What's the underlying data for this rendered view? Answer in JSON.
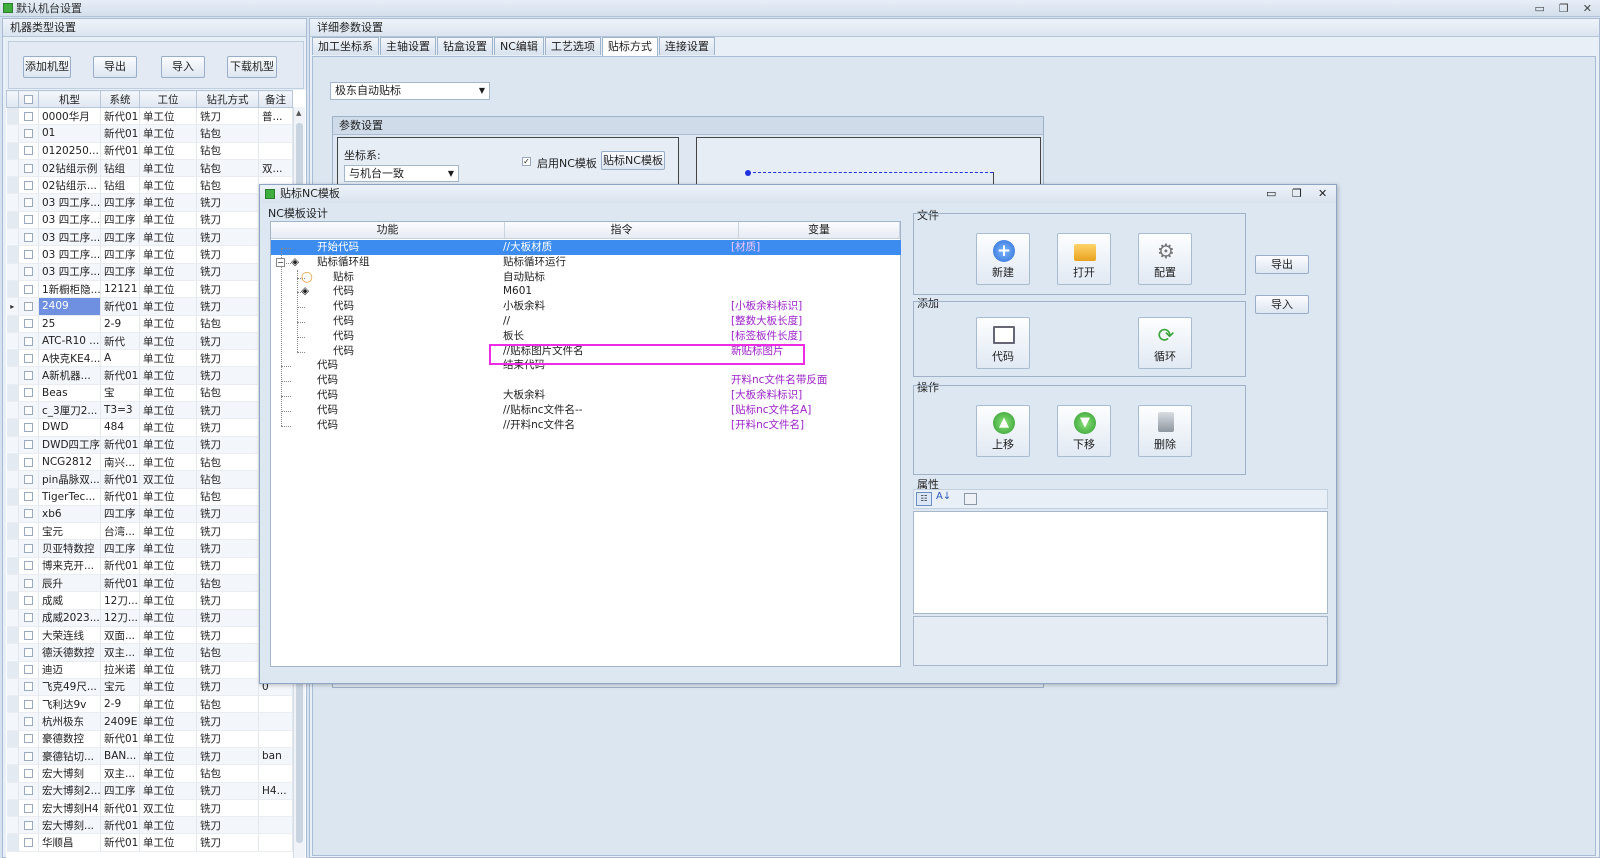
{
  "window": {
    "title": "默认机台设置",
    "controls": [
      "▭",
      "❐",
      "✕"
    ]
  },
  "machine_panel": {
    "header": "机器类型设置",
    "buttons": [
      "添加机型",
      "导出",
      "导入",
      "下载机型"
    ],
    "columns": [
      "机型",
      "系统",
      "工位",
      "钻孔方式",
      "备注"
    ],
    "rows": [
      [
        "0000华月",
        "新代01",
        "单工位",
        "铣刀",
        "普..."
      ],
      [
        "01",
        "新代01",
        "单工位",
        "钻包",
        ""
      ],
      [
        "0120250...",
        "新代01",
        "单工位",
        "钻包",
        ""
      ],
      [
        "02钻组示例",
        "钻组",
        "单工位",
        "钻包",
        "双..."
      ],
      [
        "02钻组示...",
        "钻组",
        "单工位",
        "钻包",
        ""
      ],
      [
        "03 四工序...",
        "四工序",
        "单工位",
        "铣刀",
        ""
      ],
      [
        "03 四工序...",
        "四工序",
        "单工位",
        "铣刀",
        ""
      ],
      [
        "03 四工序...",
        "四工序",
        "单工位",
        "铣刀",
        ""
      ],
      [
        "03 四工序...",
        "四工序",
        "单工位",
        "铣刀",
        ""
      ],
      [
        "03 四工序...",
        "四工序",
        "单工位",
        "铣刀",
        ""
      ],
      [
        "1新橱柜隐...",
        "12121",
        "单工位",
        "铣刀",
        ""
      ],
      [
        "2409",
        "新代01",
        "单工位",
        "铣刀",
        ""
      ],
      [
        "25",
        "2-9",
        "单工位",
        "钻包",
        ""
      ],
      [
        "ATC-R10 ...",
        "新代",
        "单工位",
        "铣刀",
        ""
      ],
      [
        "A快克KE4...",
        "A",
        "单工位",
        "铣刀",
        ""
      ],
      [
        "A新机器...",
        "新代01",
        "单工位",
        "铣刀",
        ""
      ],
      [
        "Beas",
        "宝",
        "单工位",
        "钻包",
        ""
      ],
      [
        "c_3厘刀2...",
        "T3=3",
        "单工位",
        "铣刀",
        ""
      ],
      [
        "DWD",
        "484",
        "单工位",
        "铣刀",
        ""
      ],
      [
        "DWD四工序",
        "新代01",
        "单工位",
        "铣刀",
        ""
      ],
      [
        "NCG2812",
        "南兴...",
        "单工位",
        "钻包",
        ""
      ],
      [
        "pin晶脉双...",
        "新代01",
        "双工位",
        "钻包",
        ""
      ],
      [
        "TigerTec...",
        "新代01",
        "单工位",
        "钻包",
        ""
      ],
      [
        "xb6",
        "四工序",
        "单工位",
        "铣刀",
        ""
      ],
      [
        "宝元",
        "台湾...",
        "单工位",
        "铣刀",
        ""
      ],
      [
        "贝亚特数控",
        "四工序",
        "单工位",
        "铣刀",
        ""
      ],
      [
        "博来克开...",
        "新代01",
        "单工位",
        "铣刀",
        ""
      ],
      [
        "辰升",
        "新代01",
        "单工位",
        "钻包",
        ""
      ],
      [
        "成威",
        "12刀...",
        "单工位",
        "铣刀",
        ""
      ],
      [
        "成威2023...",
        "12刀...",
        "单工位",
        "铣刀",
        ""
      ],
      [
        "大荣连线",
        "双面...",
        "单工位",
        "铣刀",
        ""
      ],
      [
        "德沃德数控",
        "双主...",
        "单工位",
        "钻包",
        ""
      ],
      [
        "迪迈",
        "拉米诺",
        "单工位",
        "铣刀",
        ""
      ],
      [
        "飞克49尺...",
        "宝元",
        "单工位",
        "铣刀",
        "0"
      ],
      [
        "飞利达9v",
        "2-9",
        "单工位",
        "钻包",
        ""
      ],
      [
        "杭州极东",
        "2409E",
        "单工位",
        "铣刀",
        ""
      ],
      [
        "豪德数控",
        "新代01",
        "单工位",
        "铣刀",
        ""
      ],
      [
        "豪德钻切...",
        "BAN...",
        "单工位",
        "铣刀",
        "ban"
      ],
      [
        "宏大博刻",
        "双主...",
        "单工位",
        "钻包",
        ""
      ],
      [
        "宏大博刻2...",
        "四工序",
        "单工位",
        "铣刀",
        "H4..."
      ],
      [
        "宏大博刻H4",
        "新代01",
        "双工位",
        "铣刀",
        ""
      ],
      [
        "宏大博刻...",
        "新代01",
        "单工位",
        "铣刀",
        ""
      ],
      [
        "华顺昌",
        "新代01",
        "单工位",
        "铣刀",
        ""
      ]
    ]
  },
  "detail_panel": {
    "header": "详细参数设置",
    "tabs": [
      "加工坐标系",
      "主轴设置",
      "钻盒设置",
      "NC编辑",
      "工艺选项",
      "贴标方式",
      "连接设置"
    ],
    "active_tab": 5,
    "label_mode": "极东自动贴标",
    "param_group": "参数设置",
    "coord_label": "坐标系:",
    "coord_value": "与机台一致",
    "enable_nc_label": "启用NC模板",
    "nc_template_button": "贴标NC模板"
  },
  "dialog": {
    "title": "贴标NC模板",
    "design_group": "NC模板设计",
    "columns": [
      "功能",
      "指令",
      "变量"
    ],
    "rows": [
      {
        "func": "开始代码",
        "cmd": "//大板材质",
        "var": "[材质]",
        "level": 0,
        "icon": "",
        "selected": true
      },
      {
        "func": "贴标循环组",
        "cmd": "贴标循环运行",
        "var": "",
        "level": 0,
        "icon": "layers",
        "selected": false
      },
      {
        "func": "贴标",
        "cmd": "自动贴标",
        "var": "",
        "level": 1,
        "icon": "ring",
        "selected": false
      },
      {
        "func": "代码",
        "cmd": "M601",
        "var": "",
        "level": 1,
        "icon": "layers",
        "selected": false
      },
      {
        "func": "代码",
        "cmd": "小板余料",
        "var": "[小板余料标识]",
        "level": 1,
        "icon": "",
        "selected": false
      },
      {
        "func": "代码",
        "cmd": "//",
        "var": "[整数大板长度]",
        "level": 1,
        "icon": "",
        "selected": false
      },
      {
        "func": "代码",
        "cmd": "板长",
        "var": "[标签板件长度]",
        "level": 1,
        "icon": "",
        "selected": false
      },
      {
        "func": "代码",
        "cmd": "//贴标图片文件名",
        "var": "新贴标图片",
        "level": 1,
        "icon": "",
        "selected": false
      },
      {
        "func": "代码",
        "cmd": "结束代码",
        "var": "",
        "level": 0,
        "icon": "",
        "selected": false
      },
      {
        "func": "代码",
        "cmd": "",
        "var": "开料nc文件名带反面",
        "level": 0,
        "icon": "",
        "selected": false
      },
      {
        "func": "代码",
        "cmd": "大板余料",
        "var": "[大板余料标识]",
        "level": 0,
        "icon": "",
        "selected": false
      },
      {
        "func": "代码",
        "cmd": "//贴标nc文件名--",
        "var": "[贴标nc文件名A]",
        "level": 0,
        "icon": "",
        "selected": false
      },
      {
        "func": "代码",
        "cmd": "//开料nc文件名",
        "var": "[开料nc文件名]",
        "level": 0,
        "icon": "",
        "selected": false
      }
    ],
    "file_group": {
      "title": "文件",
      "buttons": [
        {
          "label": "新建",
          "icon": "add-icon"
        },
        {
          "label": "打开",
          "icon": "folder-icon"
        },
        {
          "label": "配置",
          "icon": "gear-icon"
        }
      ]
    },
    "add_group": {
      "title": "添加",
      "buttons": [
        {
          "label": "代码",
          "icon": "book-icon"
        },
        {
          "label": "循环",
          "icon": "loop-icon"
        }
      ]
    },
    "op_group": {
      "title": "操作",
      "buttons": [
        {
          "label": "上移",
          "icon": "arrow-up-icon"
        },
        {
          "label": "下移",
          "icon": "arrow-down-icon"
        },
        {
          "label": "删除",
          "icon": "trash-icon"
        }
      ]
    },
    "prop_title": "属性",
    "side_buttons": [
      "导出",
      "导入"
    ]
  },
  "colors": {
    "selection": "#3c8cf0",
    "variable": "#9b22c8",
    "highlight": "#ef2be6",
    "accent_green": "#3fae3f"
  }
}
